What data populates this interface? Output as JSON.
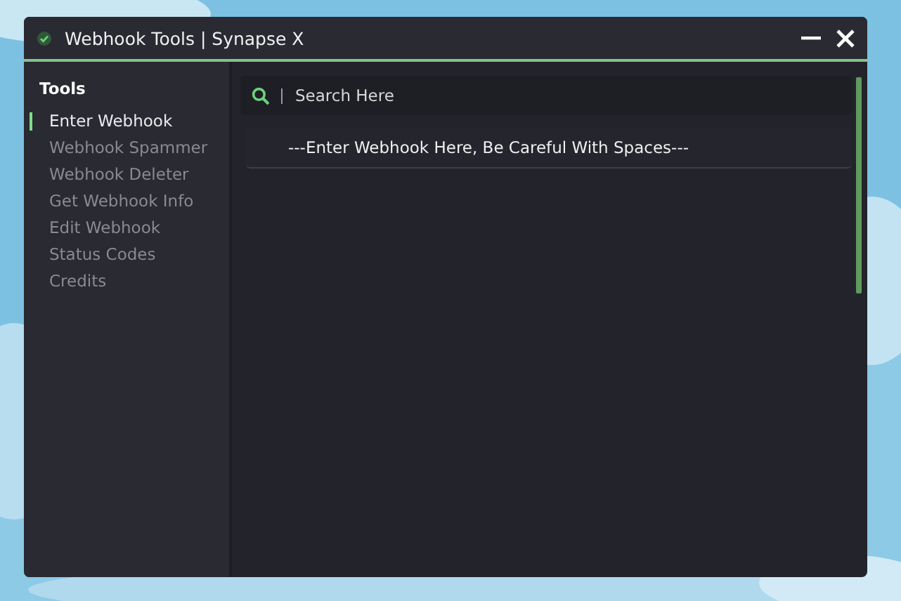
{
  "window": {
    "title": "Webhook Tools | Synapse X"
  },
  "sidebar": {
    "heading": "Tools",
    "items": [
      {
        "label": "Enter Webhook",
        "selected": true
      },
      {
        "label": "Webhook Spammer",
        "selected": false
      },
      {
        "label": "Webhook Deleter",
        "selected": false
      },
      {
        "label": "Get Webhook Info",
        "selected": false
      },
      {
        "label": "Edit Webhook",
        "selected": false
      },
      {
        "label": "Status Codes",
        "selected": false
      },
      {
        "label": "Credits",
        "selected": false
      }
    ]
  },
  "search": {
    "placeholder": "Search Here"
  },
  "webhook_field": {
    "placeholder": "---Enter Webhook Here, Be Careful With Spaces---"
  }
}
